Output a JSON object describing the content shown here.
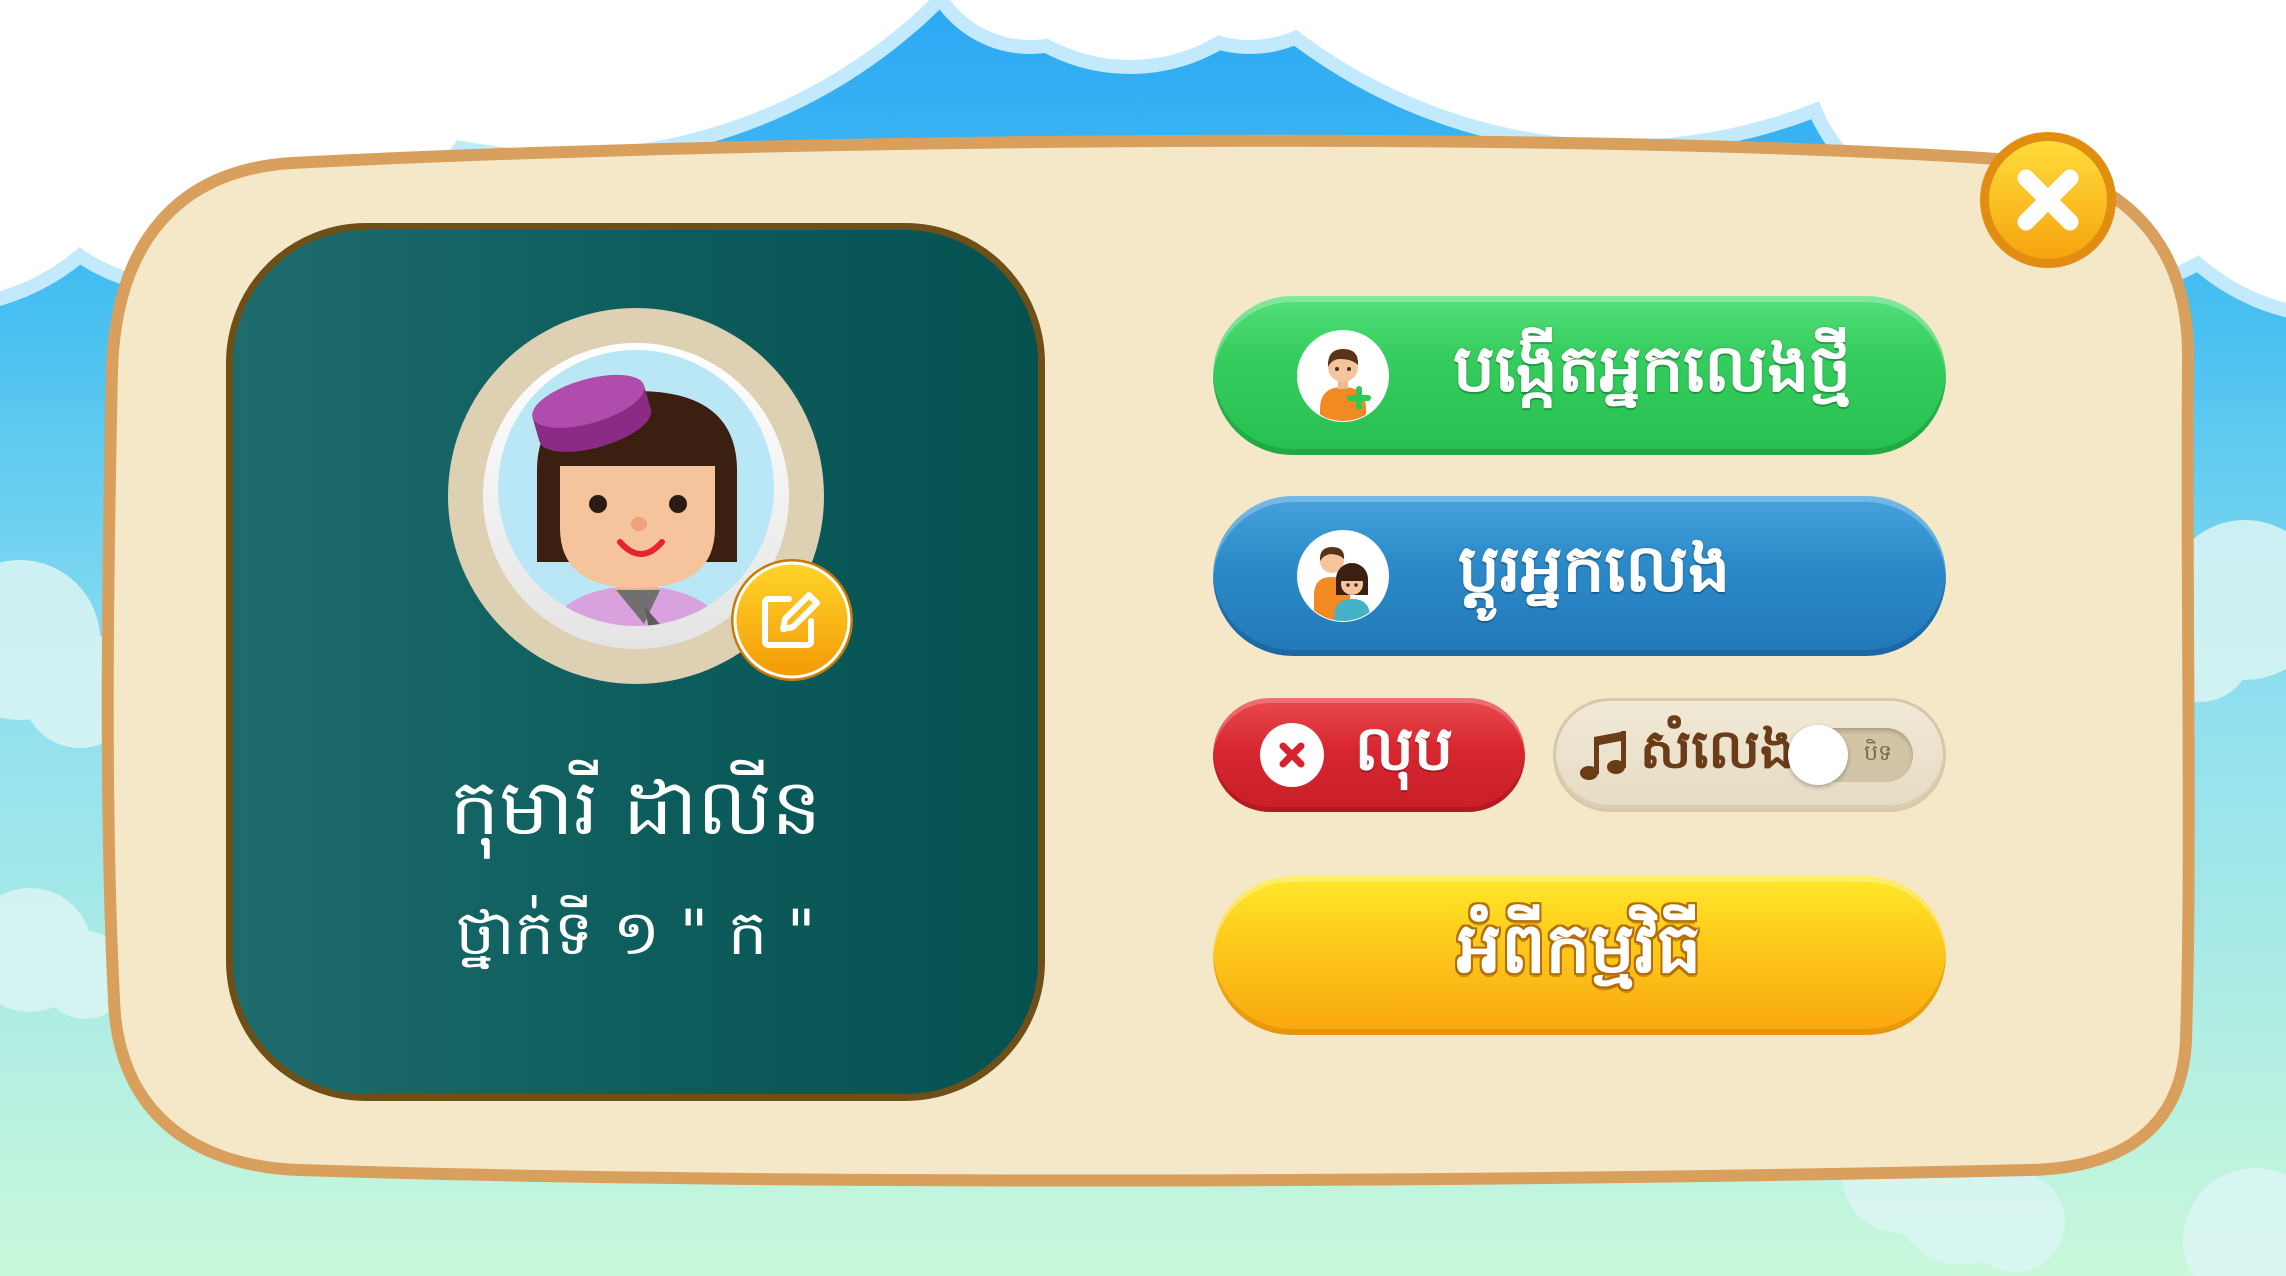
{
  "close_button": {
    "icon": "close-icon"
  },
  "profile": {
    "avatar_icon": "girl-avatar-icon",
    "edit_icon": "edit-pencil-icon",
    "name": "កុមារី ដាលីន",
    "grade": "ថ្នាក់ទី ១ \" ក \""
  },
  "menu": {
    "create_player": {
      "label": "បង្កើតអ្នកលេងថ្មី",
      "icon": "add-player-icon",
      "color": "#2cc653"
    },
    "switch_player": {
      "label": "ប្តូរអ្នកលេង",
      "icon": "switch-player-icon",
      "color": "#2a88c8"
    },
    "delete": {
      "label": "លុប",
      "icon": "delete-icon",
      "color": "#d8232c"
    },
    "sound": {
      "label": "សំលេង",
      "icon": "music-note-icon",
      "toggle_label": "បិទ",
      "enabled": false
    },
    "about": {
      "label": "អំពីកម្មវិធី",
      "color": "#fbb816"
    }
  },
  "theme": {
    "sky": "#2ca8f5",
    "panel": "#f5e8c8",
    "panel_border": "#d99f5c",
    "card": "#0b5a59",
    "accent": "#ffc21a"
  }
}
